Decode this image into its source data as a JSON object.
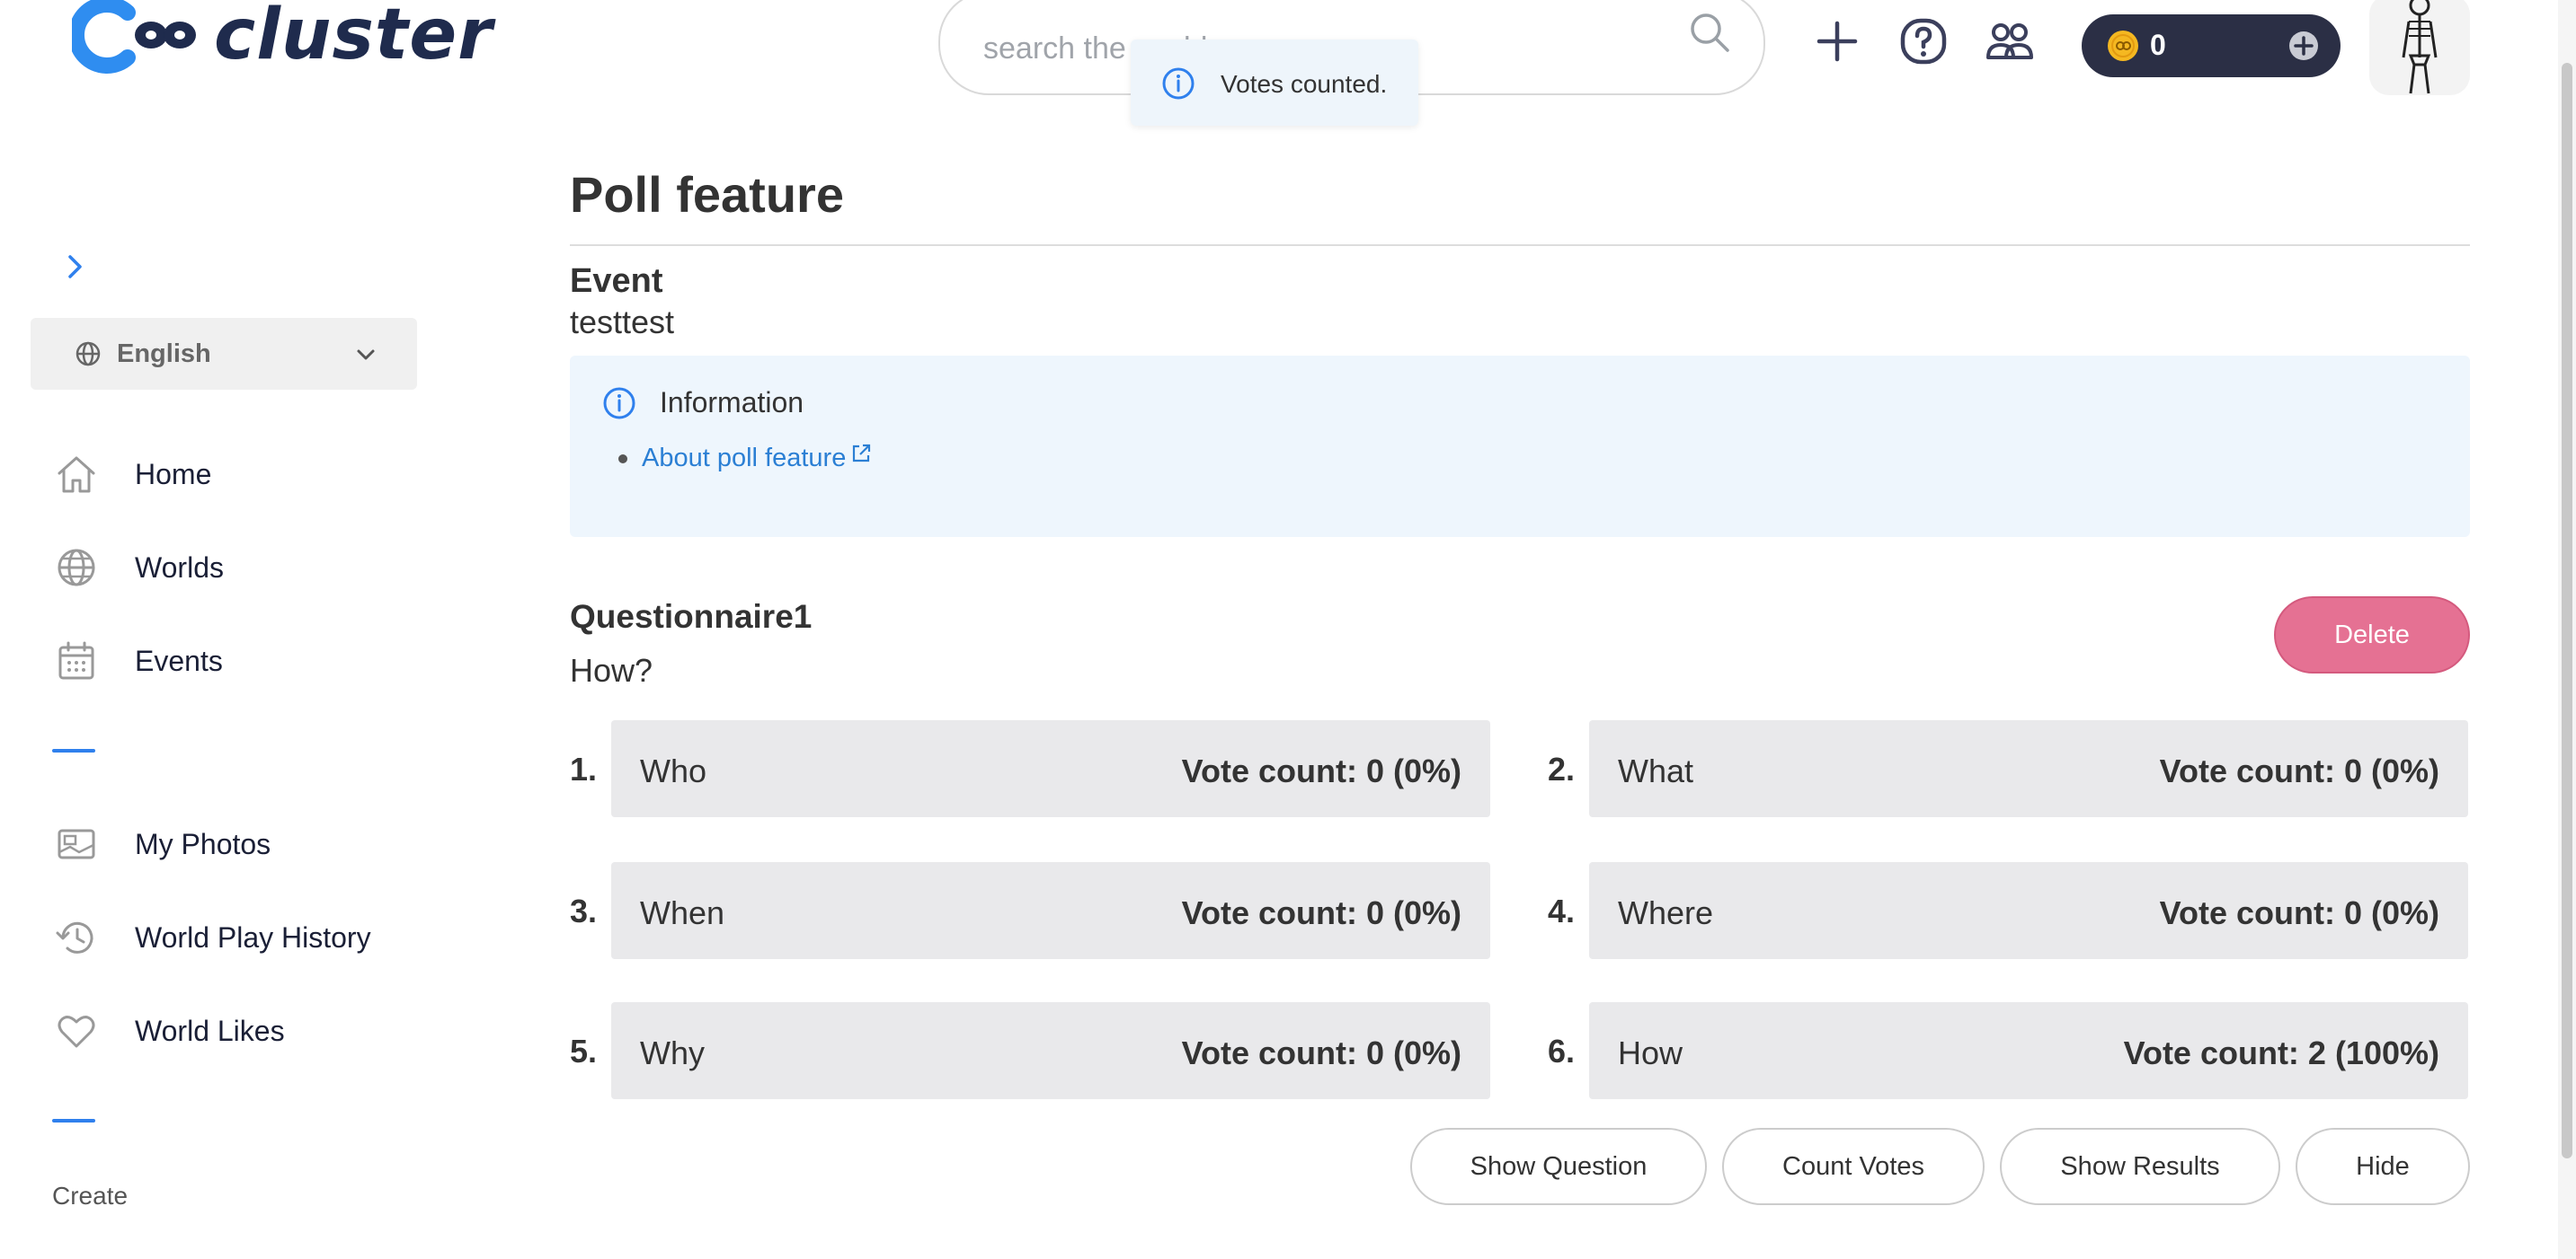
{
  "app": {
    "logo_text": "cluster",
    "search_placeholder": "search the world",
    "coin_balance": "0",
    "toast": "Votes counted.",
    "icons": [
      "search-icon",
      "plus-icon",
      "help-icon",
      "friends-icon",
      "coin-icon",
      "add-circle-icon",
      "info-icon"
    ]
  },
  "sidebar": {
    "language": "English",
    "items_top": [
      {
        "label": "Home",
        "icon": "home-icon"
      },
      {
        "label": "Worlds",
        "icon": "globe-icon"
      },
      {
        "label": "Events",
        "icon": "calendar-icon"
      }
    ],
    "items_mid": [
      {
        "label": "My Photos",
        "icon": "photos-icon"
      },
      {
        "label": "World Play History",
        "icon": "history-icon"
      },
      {
        "label": "World Likes",
        "icon": "heart-icon"
      }
    ],
    "section_create": "Create"
  },
  "main": {
    "title": "Poll feature",
    "event_heading": "Event",
    "event_name": "testtest",
    "info": {
      "title": "Information",
      "link": "About poll feature"
    },
    "questionnaire": {
      "title": "Questionnaire1",
      "question": "How?",
      "delete_label": "Delete",
      "options": [
        {
          "num": "1.",
          "label": "Who",
          "count": "Vote count: 0 (0%)"
        },
        {
          "num": "2.",
          "label": "What",
          "count": "Vote count: 0 (0%)"
        },
        {
          "num": "3.",
          "label": "When",
          "count": "Vote count: 0 (0%)"
        },
        {
          "num": "4.",
          "label": "Where",
          "count": "Vote count: 0 (0%)"
        },
        {
          "num": "5.",
          "label": "Why",
          "count": "Vote count: 0 (0%)"
        },
        {
          "num": "6.",
          "label": "How",
          "count": "Vote count: 2 (100%)"
        }
      ],
      "actions": {
        "show_question": "Show Question",
        "count_votes": "Count Votes",
        "show_results": "Show Results",
        "hide": "Hide"
      }
    }
  },
  "colors": {
    "accent": "#2f80ed",
    "delete": "#e57193",
    "info_bg": "#eef6fd",
    "option_bg": "#e9e9eb",
    "brand": "#1f2b4d"
  }
}
